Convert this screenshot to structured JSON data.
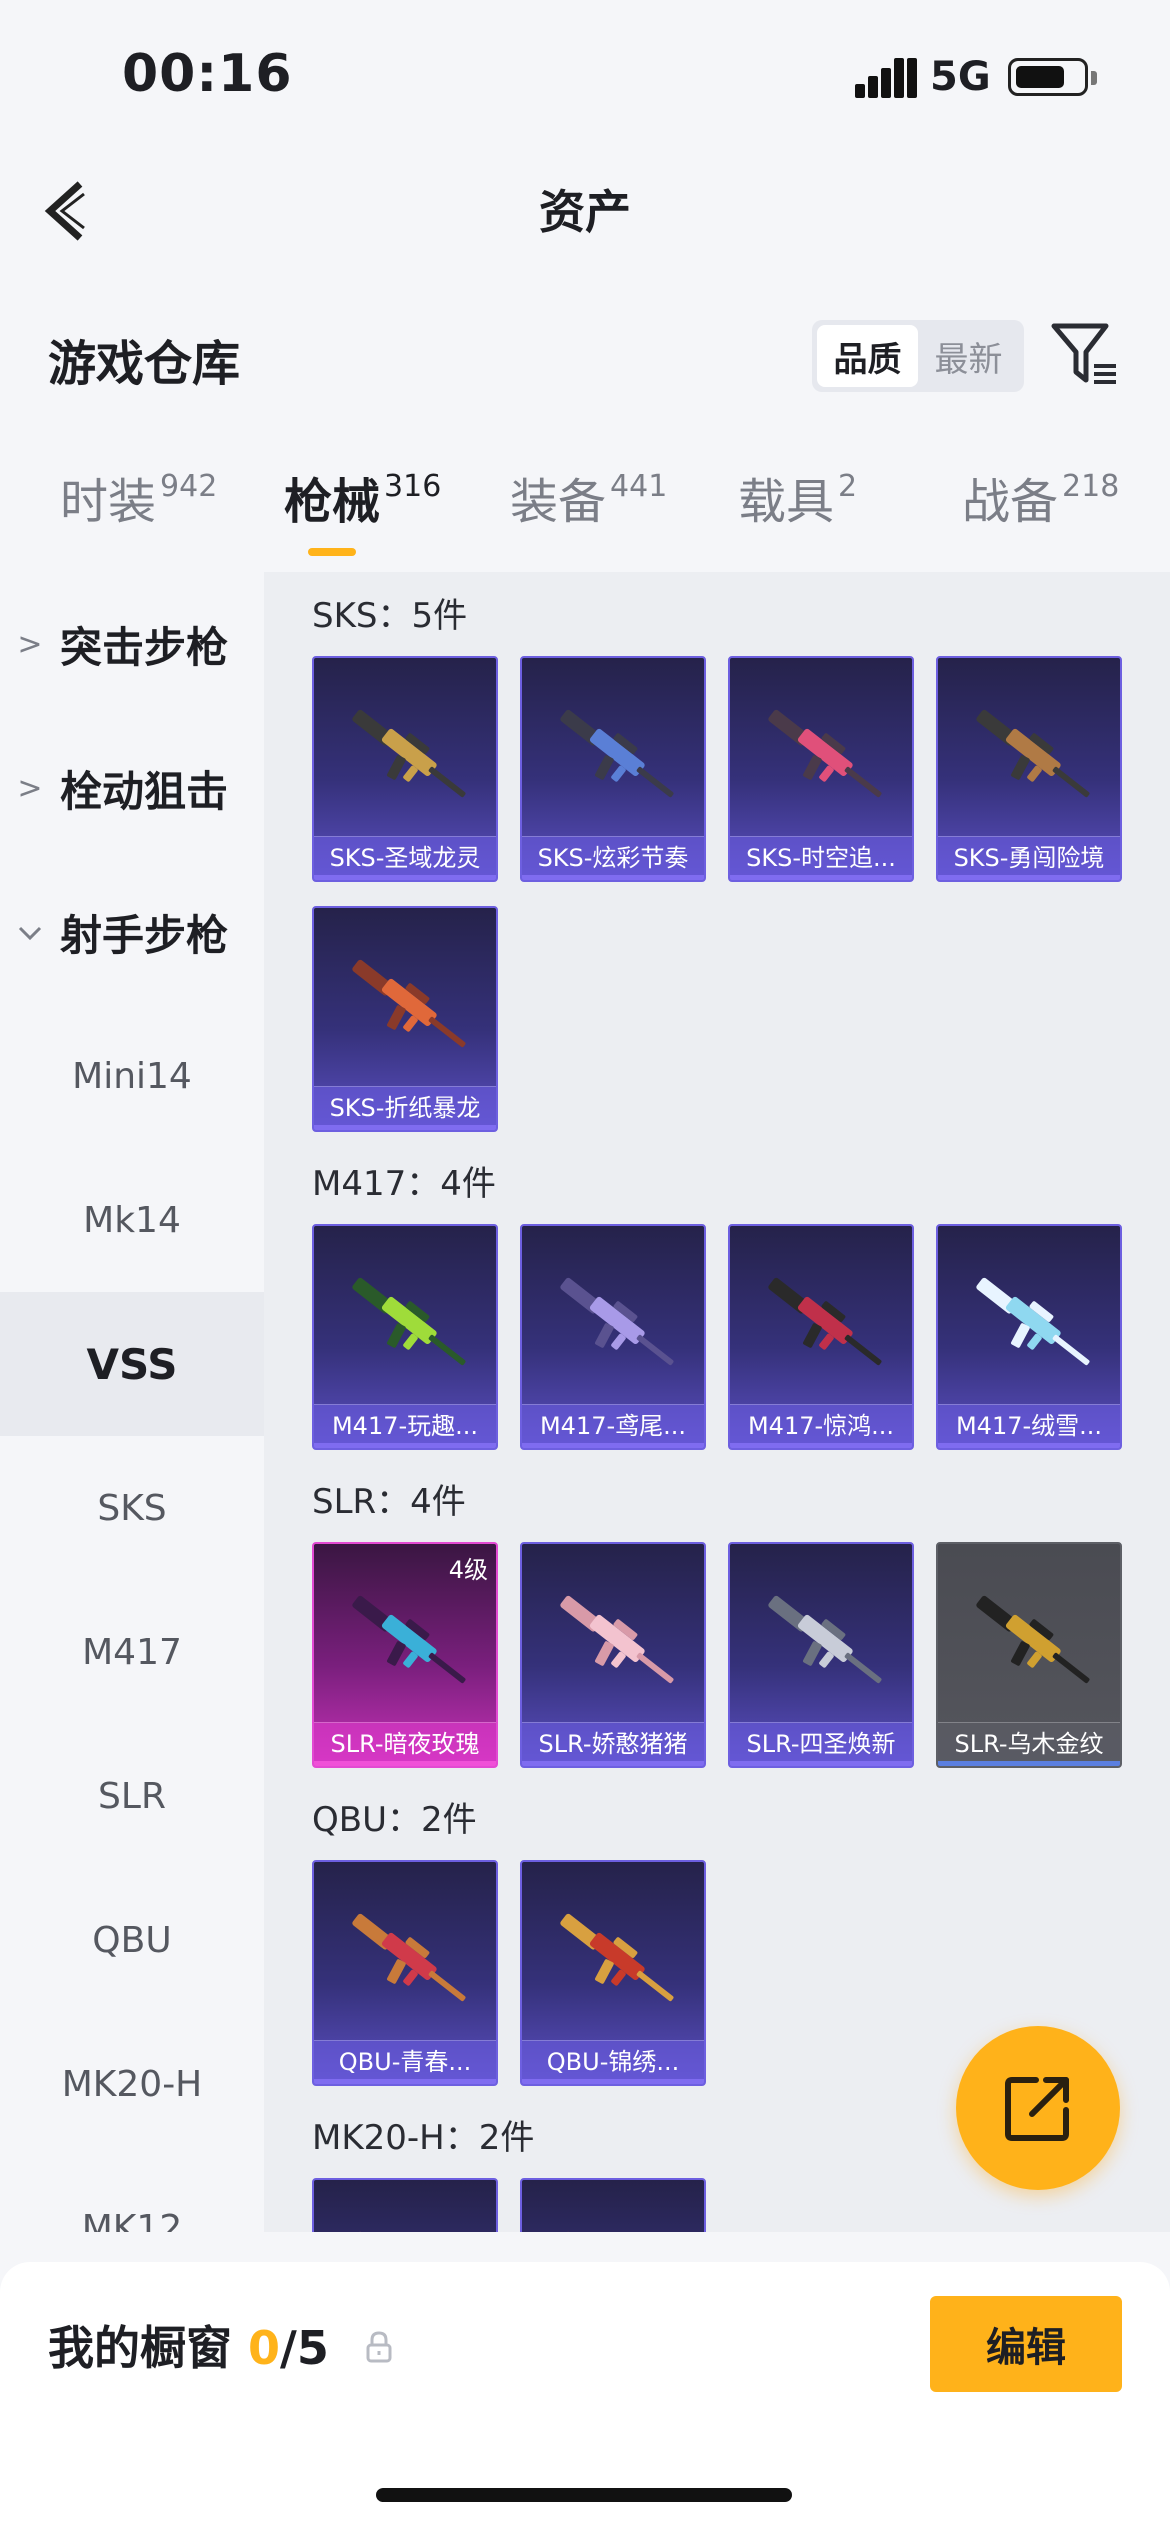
{
  "status_bar": {
    "time": "00:16",
    "network": "5G"
  },
  "header": {
    "title": "资产"
  },
  "warehouse": {
    "title": "游戏仓库",
    "sort_options": [
      "品质",
      "最新"
    ],
    "sort_selected": "品质"
  },
  "tabs": [
    {
      "label": "时装",
      "count": "942"
    },
    {
      "label": "枪械",
      "count": "316",
      "active": true
    },
    {
      "label": "装备",
      "count": "441"
    },
    {
      "label": "载具",
      "count": "2"
    },
    {
      "label": "战备",
      "count": "218"
    }
  ],
  "sidebar": {
    "categories": [
      "突击步枪",
      "栓动狙击",
      "射手步枪"
    ],
    "subs": [
      "Mini14",
      "Mk14",
      "VSS",
      "SKS",
      "M417",
      "SLR",
      "QBU",
      "MK20-H",
      "MK12"
    ],
    "active_sub": "VSS"
  },
  "sections": [
    {
      "title": "SKS：5件",
      "items": [
        "SKS-圣域龙灵",
        "SKS-炫彩节奏",
        "SKS-时空追...",
        "SKS-勇闯险境",
        "SKS-折纸暴龙"
      ]
    },
    {
      "title": "M417：4件",
      "items": [
        "M417-玩趣...",
        "M417-鸢尾...",
        "M417-惊鸿...",
        "M417-绒雪..."
      ]
    },
    {
      "title": "SLR：4件",
      "items": [
        "SLR-暗夜玫瑰",
        "SLR-娇憨猪猪",
        "SLR-四圣焕新",
        "SLR-乌木金纹"
      ],
      "tier_badge": "4级"
    },
    {
      "title": "QBU：2件",
      "items": [
        "QBU-青春...",
        "QBU-锦绣..."
      ]
    },
    {
      "title": "MK20-H：2件",
      "items": [
        "",
        ""
      ]
    }
  ],
  "showcase": {
    "label": "我的橱窗",
    "current": "0",
    "total": "/5"
  },
  "edit_button": "编辑",
  "colors": {
    "accent": "#ffb21a",
    "card_purple": "#35317a",
    "card_pink": "#c632b7",
    "card_grey": "#55565d"
  },
  "gun_colors": [
    [
      "#c9a04a",
      "#3a3a3a"
    ],
    [
      "#5a7fd6",
      "#3b3b4a"
    ],
    [
      "#e0507a",
      "#4a3a4a"
    ],
    [
      "#b07a45",
      "#3a3a3a"
    ],
    [
      "#e0683a",
      "#8a3a2a"
    ],
    [
      "#9fdc3a",
      "#2a5a2a"
    ],
    [
      "#a89ae8",
      "#5a5290"
    ],
    [
      "#c0304a",
      "#2a2a2a"
    ],
    [
      "#8fd8f0",
      "#e8f4ff"
    ],
    [
      "#3ab0d8",
      "#3a1a4a"
    ],
    [
      "#f3c3cf",
      "#d89aa8"
    ],
    [
      "#c8ccd8",
      "#6a7080"
    ],
    [
      "#d0a030",
      "#222222"
    ],
    [
      "#d03a4a",
      "#c87a3a"
    ],
    [
      "#c83a2a",
      "#d8a040"
    ],
    [
      "#f0a0b0",
      "#c8607a"
    ],
    [
      "#f09060",
      "#a04030"
    ]
  ]
}
